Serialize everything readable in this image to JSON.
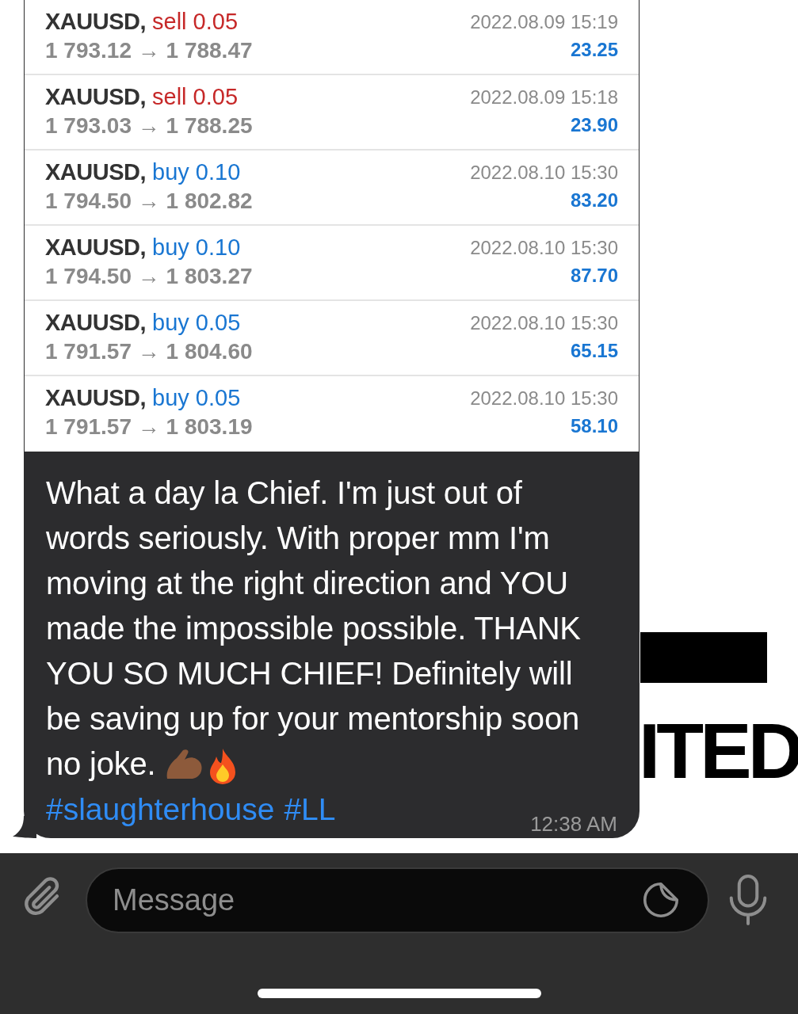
{
  "trades": [
    {
      "symbol": "XAUUSD,",
      "kind": "sell",
      "order": "sell 0.05",
      "prices": "1 793.12 → 1 788.47",
      "time": "2022.08.09 15:19",
      "profit": "23.25"
    },
    {
      "symbol": "XAUUSD,",
      "kind": "sell",
      "order": "sell 0.05",
      "prices": "1 793.03 → 1 788.25",
      "time": "2022.08.09 15:18",
      "profit": "23.90"
    },
    {
      "symbol": "XAUUSD,",
      "kind": "buy",
      "order": "buy 0.10",
      "prices": "1 794.50 → 1 802.82",
      "time": "2022.08.10 15:30",
      "profit": "83.20"
    },
    {
      "symbol": "XAUUSD,",
      "kind": "buy",
      "order": "buy 0.10",
      "prices": "1 794.50 → 1 803.27",
      "time": "2022.08.10 15:30",
      "profit": "87.70"
    },
    {
      "symbol": "XAUUSD,",
      "kind": "buy",
      "order": "buy 0.05",
      "prices": "1 791.57 → 1 804.60",
      "time": "2022.08.10 15:30",
      "profit": "65.15"
    },
    {
      "symbol": "XAUUSD,",
      "kind": "buy",
      "order": "buy 0.05",
      "prices": "1 791.57 → 1 803.19",
      "time": "2022.08.10 15:30",
      "profit": "58.10"
    }
  ],
  "message": {
    "text": "What a day la Chief. I'm just out of words seriously. With proper mm I'm moving at the right direction and YOU made the impossible possible. THANK YOU SO MUCH CHIEF! Definitely will be saving up for your mentorship soon no joke.",
    "hashtags": [
      "#slaughterhouse",
      "#LL"
    ],
    "time": "12:38 AM"
  },
  "background_text": "ITED",
  "composer": {
    "placeholder": "Message"
  }
}
